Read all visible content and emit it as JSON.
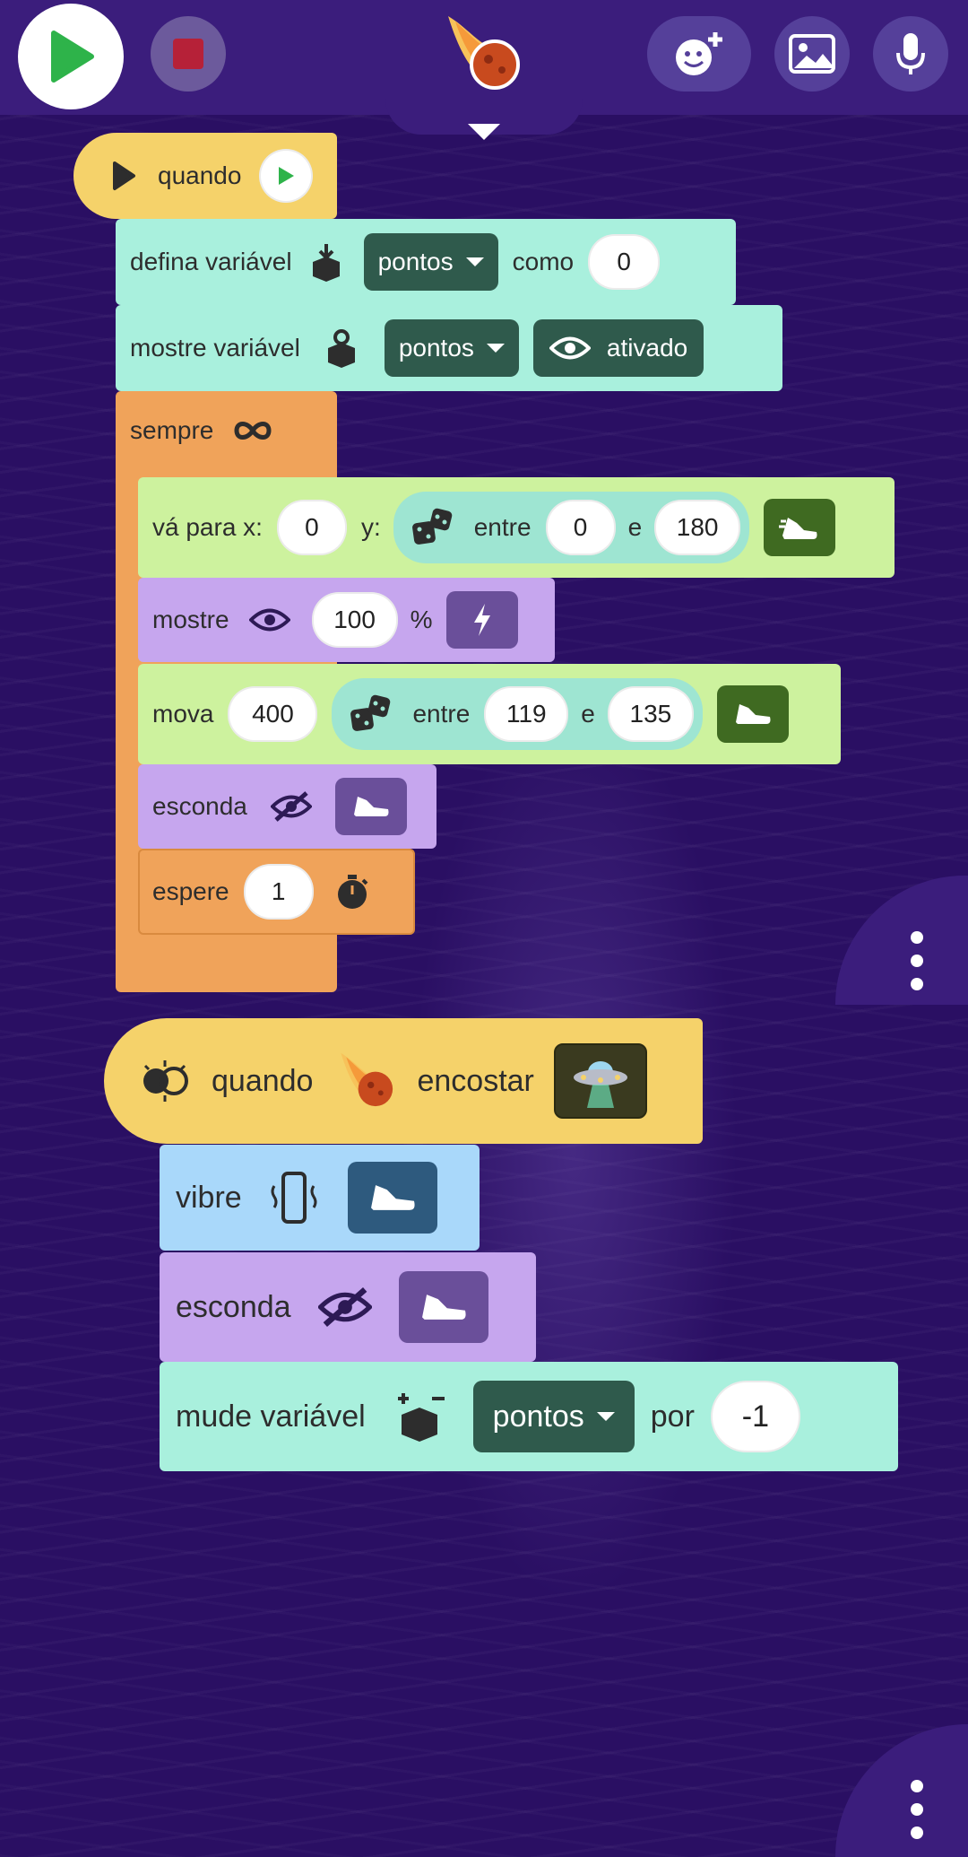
{
  "toolbar": {
    "play": "play-icon",
    "stop": "stop-icon",
    "add_character": "add-character-icon",
    "backgrounds": "image-icon",
    "microphone": "microphone-icon",
    "character": "fireball-meteor-character",
    "colors": {
      "bar": "#3b1d7c",
      "play": "#2eb34a",
      "stop": "#b62138"
    }
  },
  "script1": {
    "hat": {
      "label": "quando"
    },
    "set_var": {
      "label": "defina variável",
      "variable": "pontos",
      "connector": "como",
      "value": "0"
    },
    "show_var": {
      "label": "mostre variável",
      "variable": "pontos",
      "state": "ativado"
    },
    "forever": {
      "label": "sempre"
    },
    "goto": {
      "label": "vá para x:",
      "x": "0",
      "y_label": "y:",
      "between": "entre",
      "min": "0",
      "and": "e",
      "max": "180"
    },
    "show": {
      "label": "mostre",
      "value": "100",
      "unit": "%"
    },
    "move": {
      "label": "mova",
      "value": "400",
      "between": "entre",
      "min": "119",
      "and": "e",
      "max": "135"
    },
    "hide": {
      "label": "esconda"
    },
    "wait": {
      "label": "espere",
      "value": "1"
    }
  },
  "script2": {
    "hat": {
      "label": "quando",
      "action": "encostar",
      "target": "ufo-character"
    },
    "vibrate": {
      "label": "vibre"
    },
    "hide": {
      "label": "esconda"
    },
    "change_var": {
      "label": "mude variável",
      "variable": "pontos",
      "connector": "por",
      "value": "-1"
    }
  }
}
